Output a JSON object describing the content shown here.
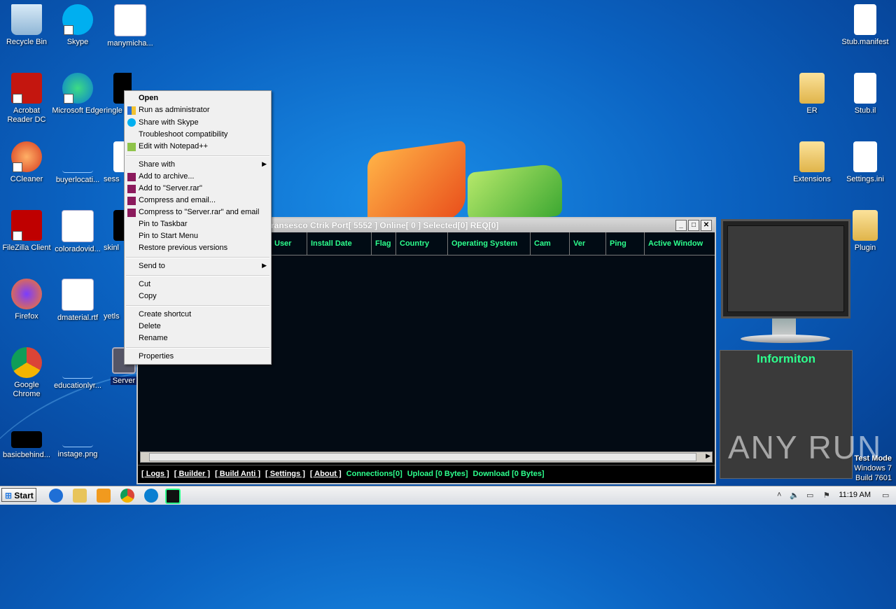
{
  "desktop_icons": [
    {
      "label": "Recycle Bin",
      "icon": "recycle-bin-icon"
    },
    {
      "label": "Skype",
      "icon": "skype-icon"
    },
    {
      "label": "manymicha...",
      "icon": "word-doc-icon"
    },
    {
      "label": "Acrobat Reader DC",
      "icon": "acrobat-icon"
    },
    {
      "label": "Microsoft Edge",
      "icon": "edge-icon"
    },
    {
      "label": "ringle",
      "icon": "file-icon"
    },
    {
      "label": "CCleaner",
      "icon": "ccleaner-icon"
    },
    {
      "label": "buyerlocati...",
      "icon": "file-icon"
    },
    {
      "label": "sess",
      "icon": "word-doc-icon"
    },
    {
      "label": "FileZilla Client",
      "icon": "filezilla-icon"
    },
    {
      "label": "coloradovid...",
      "icon": "word-doc-icon"
    },
    {
      "label": "skinl",
      "icon": "file-icon"
    },
    {
      "label": "Firefox",
      "icon": "firefox-icon"
    },
    {
      "label": "dmaterial.rtf",
      "icon": "word-doc-icon"
    },
    {
      "label": "yetls",
      "icon": "file-icon"
    },
    {
      "label": "Google Chrome",
      "icon": "chrome-icon"
    },
    {
      "label": "educationlyr...",
      "icon": "file-icon"
    },
    {
      "label": "Server",
      "icon": "server-exe-icon"
    },
    {
      "label": "basicbehind...",
      "icon": "file-icon"
    },
    {
      "label": "instage.png",
      "icon": "image-icon"
    },
    {
      "label": "Stub.manifest",
      "icon": "file-icon"
    },
    {
      "label": "ER",
      "icon": "folder-icon"
    },
    {
      "label": "Stub.il",
      "icon": "file-icon"
    },
    {
      "label": "Extensions",
      "icon": "folder-icon"
    },
    {
      "label": "Settings.ini",
      "icon": "settings-file-icon"
    },
    {
      "label": "Plugin",
      "icon": "folder-icon"
    }
  ],
  "rat_window": {
    "title": "ransesco Ctrik   Port[ 5552 ]   Online[ 0 ]   Selected[0] REQ[0]",
    "columns": [
      "User",
      "Install Date",
      "Flag",
      "Country",
      "Operating System",
      "Cam",
      "Ver",
      "Ping",
      "Active Window"
    ],
    "footer": {
      "logs": "[ Logs ]",
      "builder": "[ Builder ]",
      "build_anti": "[ Build Anti ]",
      "settings": "[ Settings ]",
      "about": "[ About ]",
      "connections": "Connections[0]",
      "upload": "Upload [0 Bytes]",
      "download": "Download [0 Bytes]"
    }
  },
  "context_menu": {
    "open": "Open",
    "run_admin": "Run as administrator",
    "share_skype": "Share with Skype",
    "troubleshoot": "Troubleshoot compatibility",
    "notepad": "Edit with Notepad++",
    "share_with": "Share with",
    "add_archive": "Add to archive...",
    "add_rar": "Add to \"Server.rar\"",
    "compress_email": "Compress and email...",
    "compress_rar_email": "Compress to \"Server.rar\" and email",
    "pin_taskbar": "Pin to Taskbar",
    "pin_start": "Pin to Start Menu",
    "restore": "Restore previous versions",
    "send_to": "Send to",
    "cut": "Cut",
    "copy": "Copy",
    "create_shortcut": "Create shortcut",
    "delete": "Delete",
    "rename": "Rename",
    "properties": "Properties"
  },
  "info_panel": {
    "title": "Informiton"
  },
  "watermark": "ANY RUN",
  "test_mode": {
    "line1": "Test Mode",
    "line2": "Windows 7",
    "line3": "Build 7601"
  },
  "taskbar": {
    "start": "Start",
    "time": "11:19 AM"
  }
}
